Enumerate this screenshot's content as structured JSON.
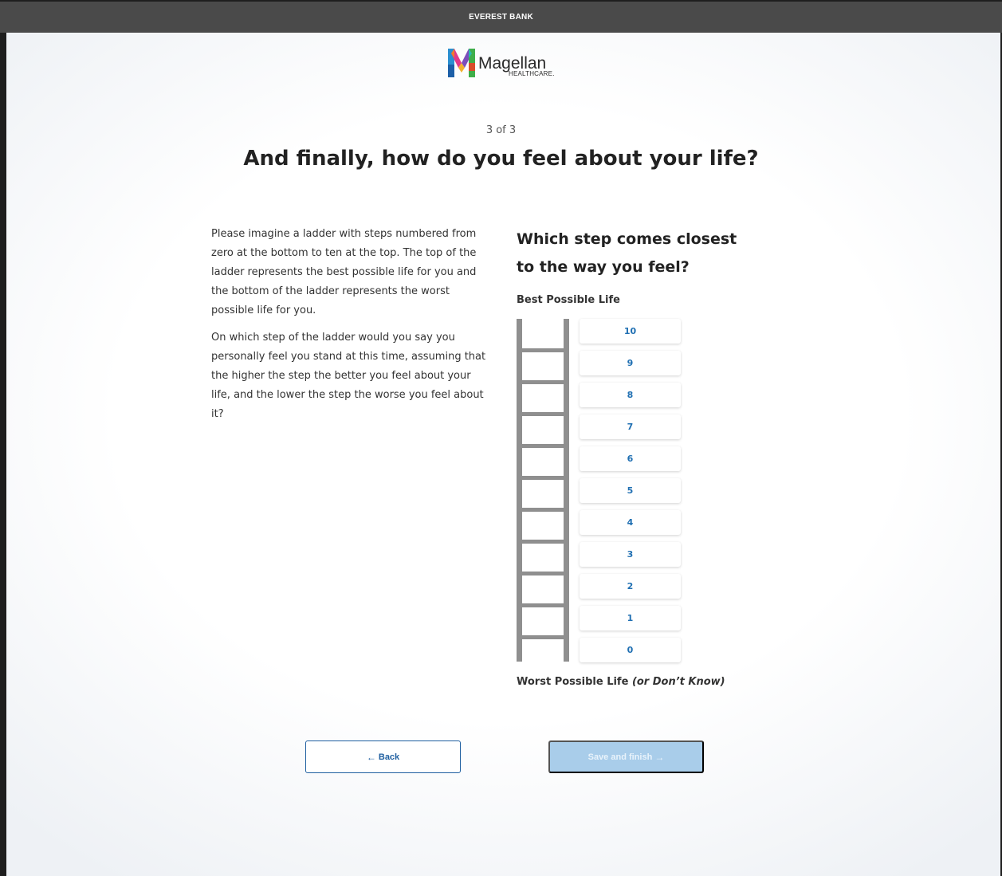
{
  "header": {
    "bank_name": "EVEREST BANK"
  },
  "logo": {
    "name": "Magellan",
    "sub": "HEALTHCARE."
  },
  "progress": {
    "text": "3 of 3"
  },
  "title": "And finally, how do you feel about your life?",
  "description": {
    "p1": "Please imagine a ladder with steps numbered from zero at the bottom to ten at the top. The top of the ladder represents the best possible life for you and the bottom of the ladder represents the worst possible life for you.",
    "p2": "On which step of the ladder would you say you personally feel you stand at this time, assuming that the higher the step the better you feel about your life, and the lower the step the worse you feel about it?"
  },
  "question": "Which step comes closest to the way you feel?",
  "best_label": "Best Possible Life",
  "worst_label": "Worst Possible Life",
  "worst_label_note": "(or Don’t Know)",
  "options": [
    "10",
    "9",
    "8",
    "7",
    "6",
    "5",
    "4",
    "3",
    "2",
    "1",
    "0"
  ],
  "buttons": {
    "back_arrow": "←",
    "back_label": "Back",
    "save_label": "Save and finish",
    "save_arrow": "→"
  },
  "colors": {
    "topbar": "#4a4a4a",
    "link_blue": "#1f6fb2",
    "save_disabled": "#a9cdea",
    "ladder_gray": "#8f8f8f"
  }
}
